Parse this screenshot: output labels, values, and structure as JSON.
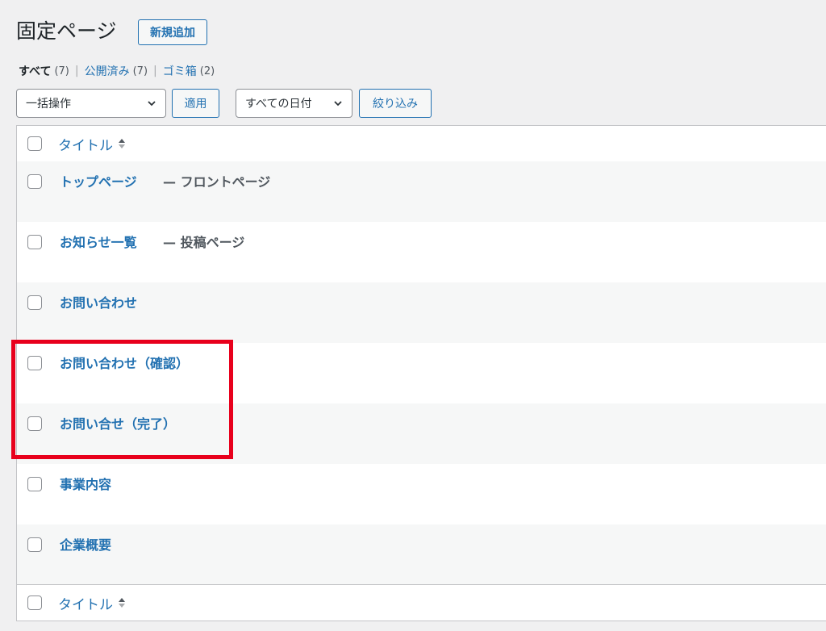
{
  "header": {
    "title": "固定ページ",
    "add_new_label": "新規追加"
  },
  "filters": {
    "all_label": "すべて",
    "all_count": "(7)",
    "published_label": "公開済み",
    "published_count": "(7)",
    "trash_label": "ゴミ箱",
    "trash_count": "(2)",
    "separator": "|"
  },
  "tablenav": {
    "bulk_action_selected": "一括操作",
    "apply_label": "適用",
    "date_filter_selected": "すべての日付",
    "filter_label": "絞り込み"
  },
  "table": {
    "column_title": "タイトル",
    "rows": [
      {
        "title": "トップページ",
        "state": "— フロントページ"
      },
      {
        "title": "お知らせ一覧",
        "state": "— 投稿ページ"
      },
      {
        "title": "お問い合わせ",
        "state": ""
      },
      {
        "title": "お問い合わせ（確認）",
        "state": ""
      },
      {
        "title": "お問い合せ（完了）",
        "state": ""
      },
      {
        "title": "事業内容",
        "state": ""
      },
      {
        "title": "企業概要",
        "state": ""
      }
    ]
  },
  "colors": {
    "link": "#2271b1",
    "highlight": "#e8001c",
    "background": "#f0f0f1"
  }
}
